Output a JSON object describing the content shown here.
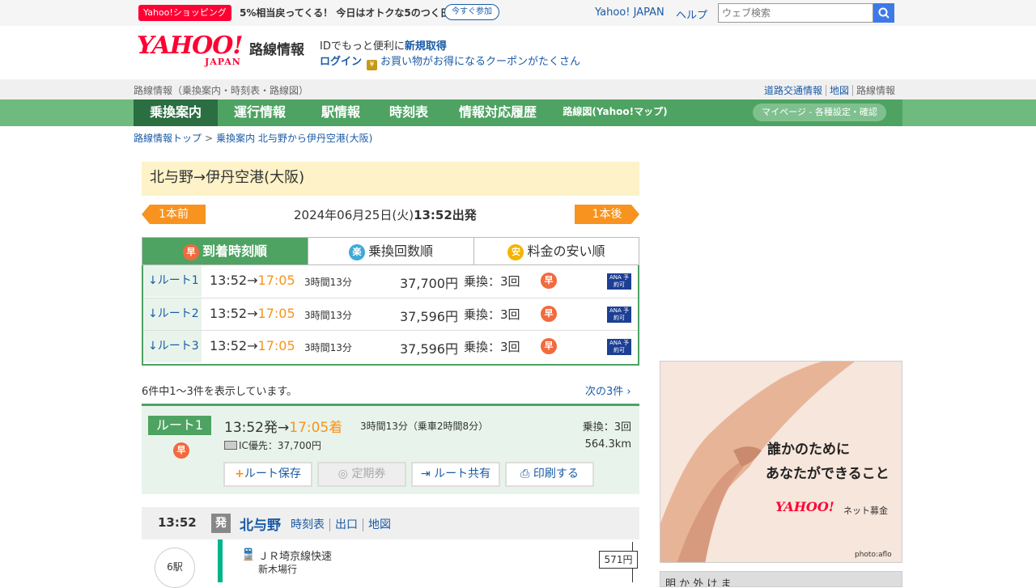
{
  "promo": {
    "badge": "Yahoo!ショッピング",
    "text": "5%相当戻ってくる！ 今日はオトクな5のつく日",
    "button": "今すぐ参加"
  },
  "top_links": {
    "yahoo_japan": "Yahoo! JAPAN",
    "help": "ヘルプ"
  },
  "search": {
    "placeholder": "ウェブ検索"
  },
  "header": {
    "logo_main": "YAHOO!",
    "logo_sub": "JAPAN",
    "site_name": "路線情報",
    "id_text": "IDでもっと便利に",
    "id_link": "新規取得",
    "login": "ログイン",
    "coupon": "お買い物がお得になるクーポンがたくさん"
  },
  "subbar": {
    "description": "路線情報（乗換案内・時刻表・路線図）",
    "links": [
      "道路交通情報",
      "地図",
      "路線情報"
    ]
  },
  "nav": {
    "tabs": [
      "乗換案内",
      "運行情報",
      "駅情報",
      "時刻表",
      "情報対応履歴",
      "路線図(Yahoo!マップ)"
    ],
    "mypage": "マイページ - 各種設定・確認"
  },
  "breadcrumb": {
    "top": "路線情報トップ",
    "sep": ">",
    "current": "乗換案内 北与野から伊丹空港(大阪)"
  },
  "search_result": {
    "title": "北与野→伊丹空港(大阪)",
    "prev": "1本前",
    "next": "1本後",
    "date": "2024年06月25日(火)",
    "time_label": "13:52出発"
  },
  "sort_tabs": [
    {
      "icon": "早",
      "label": "到着時刻順",
      "color": "#f26a3e"
    },
    {
      "icon": "楽",
      "label": "乗換回数順",
      "color": "#3fa9d6"
    },
    {
      "icon": "安",
      "label": "料金の安い順",
      "color": "#f4b400"
    }
  ],
  "routes": [
    {
      "label": "↓ルート1",
      "dep": "13:52→",
      "arr": "17:05",
      "duration": "3時間13分",
      "fare": "37,700円",
      "transfers": "乗換：3回",
      "icon": "早",
      "ana": "ANA 予約可"
    },
    {
      "label": "↓ルート2",
      "dep": "13:52→",
      "arr": "17:05",
      "duration": "3時間13分",
      "fare": "37,596円",
      "transfers": "乗換：3回",
      "icon": "早",
      "ana": "ANA 予約可"
    },
    {
      "label": "↓ルート3",
      "dep": "13:52→",
      "arr": "17:05",
      "duration": "3時間13分",
      "fare": "37,596円",
      "transfers": "乗換：3回",
      "icon": "早",
      "ana": "ANA 予約可"
    }
  ],
  "count_text": "6件中1～3件を表示しています。",
  "next3": "次の3件",
  "detail": {
    "badge": "ルート1",
    "dep": "13:52発→",
    "arr": "17:05着",
    "duration": "3時間13分（乗車2時間8分）",
    "transfers": "乗換：3回",
    "ic_fare": "IC優先：37,700円",
    "distance": "564.3km",
    "buttons": [
      "ルート保存",
      "定期券",
      "ルート共有",
      "印刷する"
    ]
  },
  "station": {
    "time": "13:52",
    "mark": "発",
    "name": "北与野",
    "links": [
      "時刻表",
      "出口",
      "地図"
    ],
    "stops": "6駅",
    "train": "ＪＲ埼京線快速",
    "dest": "新木場行",
    "fare": "571円"
  },
  "ad": {
    "line1": "誰かのために",
    "line2": "あなたができること",
    "brand": "YAHOO!",
    "brand_sub": "ネット募金",
    "credit": "photo:aflo"
  },
  "ad2": {
    "text": "明 か 外 け ま"
  }
}
